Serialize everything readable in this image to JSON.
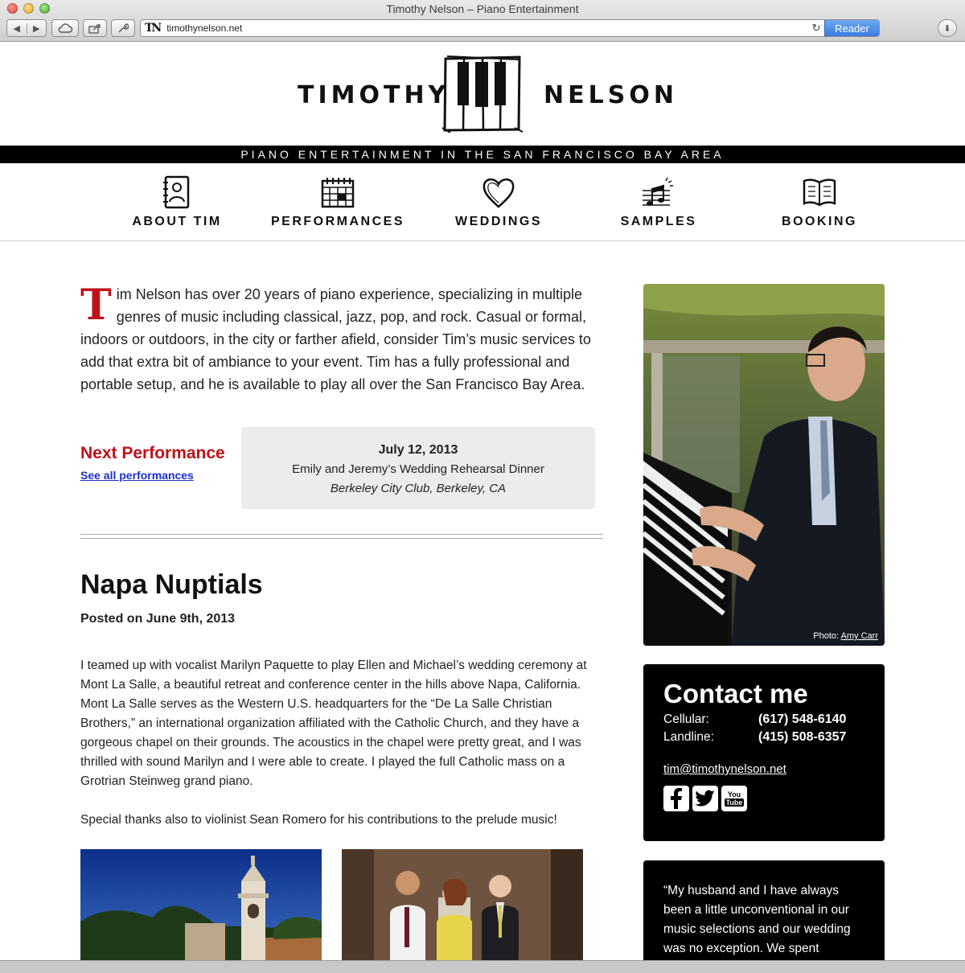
{
  "browser": {
    "window_title": "Timothy Nelson – Piano Entertainment",
    "url": "timothynelson.net",
    "reader_label": "Reader",
    "favicon_text": "TN"
  },
  "header": {
    "logo_left": "TIMOTHY",
    "logo_right": "NELSON",
    "tagline": "PIANO ENTERTAINMENT IN THE SAN FRANCISCO BAY AREA"
  },
  "nav": {
    "items": [
      {
        "label": "ABOUT TIM",
        "icon": "address-book-icon"
      },
      {
        "label": "PERFORMANCES",
        "icon": "calendar-icon"
      },
      {
        "label": "WEDDINGS",
        "icon": "heart-icon"
      },
      {
        "label": "SAMPLES",
        "icon": "music-notes-icon"
      },
      {
        "label": "BOOKING",
        "icon": "open-book-icon"
      }
    ]
  },
  "intro": {
    "dropcap": "T",
    "text": "im Nelson has over 20 years of piano experience, specializing in multiple genres of music including classical, jazz, pop, and rock.  Casual or formal, indoors or outdoors, in the city or farther afield, consider Tim’s music services to add that extra bit of ambiance to your event.  Tim has a fully professional and portable setup, and he is available to play all over the San Francisco Bay Area."
  },
  "next_performance": {
    "title": "Next Performance",
    "link": "See all performances",
    "date": "July 12, 2013",
    "event": "Emily and Jeremy’s Wedding Rehearsal Dinner",
    "venue": "Berkeley City Club, Berkeley, CA"
  },
  "post": {
    "title": "Napa Nuptials",
    "date": "Posted on June 9th, 2013",
    "paragraphs": [
      "I teamed up with vocalist Marilyn Paquette to play Ellen and Michael’s wedding ceremony at Mont La Salle, a beautiful retreat and conference center in the hills above Napa, California.  Mont La Salle serves as the Western U.S. headquarters for the “De La Salle Christian Brothers,” an international organization affiliated with the Catholic Church, and they have a gorgeous chapel on their grounds.  The acoustics in the chapel were pretty great, and I was thrilled with sound Marilyn and I were able to create.  I played the full Catholic mass on a Grotrian Steinweg grand piano.",
      "Special thanks also to violinist Sean Romero for his contributions to the prelude music!"
    ]
  },
  "sidebar": {
    "photo_credit_prefix": "Photo: ",
    "photo_credit_name": "Amy Carr",
    "contact": {
      "title": "Contact me",
      "cellular_label": "Cellular:",
      "cellular": "(617) 548-6140",
      "landline_label": "Landline:",
      "landline": "(415) 508-6357",
      "email": "tim@timothynelson.net",
      "social": [
        "facebook-icon",
        "twitter-icon",
        "youtube-icon"
      ],
      "yt_top": "You",
      "yt_bottom": "Tube"
    },
    "quote": "“My husband and I have always been a little unconventional in our music selections and our wedding was no exception. We spent"
  },
  "colors": {
    "accent_red": "#c0101a",
    "link_blue": "#1a2fd3",
    "bar_black": "#000000",
    "box_gray": "#ececec"
  }
}
